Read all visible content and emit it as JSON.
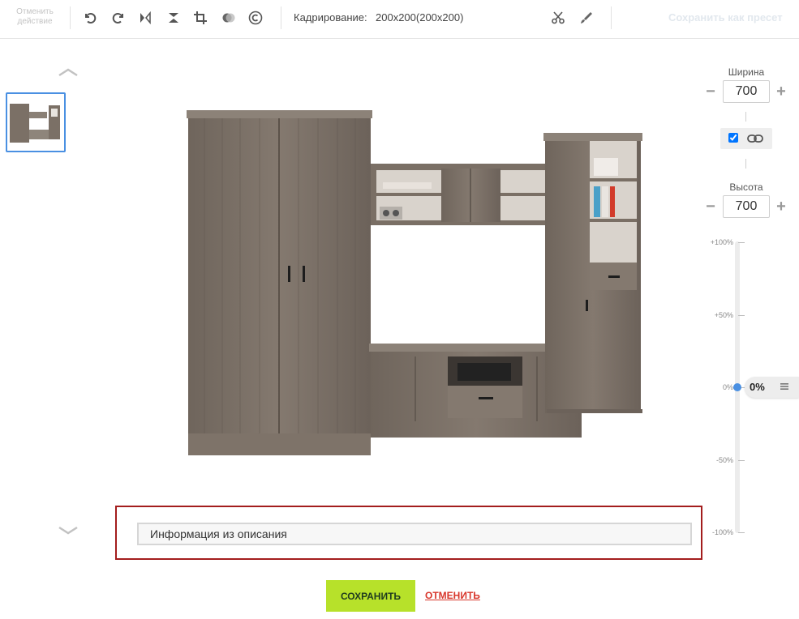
{
  "toolbar": {
    "undo_label": "Отменить действие",
    "crop_label": "Кадрирование:",
    "crop_value": "200x200(200x200)",
    "save_preset_label": "Сохранить как пресет",
    "icons": [
      "rotate-left-icon",
      "rotate-right-icon",
      "flip-horizontal-icon",
      "flip-vertical-icon",
      "crop-icon",
      "color-adjust-icon",
      "copyright-icon",
      "scissors-icon",
      "brush-icon"
    ]
  },
  "dimensions": {
    "width_label": "Ширина",
    "width_value": "700",
    "height_label": "Высота",
    "height_value": "700",
    "minus": "−",
    "plus": "+",
    "keep_ratio_checked": true
  },
  "scale": {
    "labels": [
      "+100%",
      "+50%",
      "0%",
      "-50%",
      "-100%"
    ],
    "current": "0%"
  },
  "description": {
    "value": "Информация из описания"
  },
  "actions": {
    "save_label": "СОХРАНИТЬ",
    "cancel_label": "ОТМЕНИТЬ"
  },
  "colors": {
    "accent": "#4a90e2",
    "save_button": "#b7e12a",
    "cancel_text": "#d8362b",
    "highlight_border": "#a31d1d"
  }
}
